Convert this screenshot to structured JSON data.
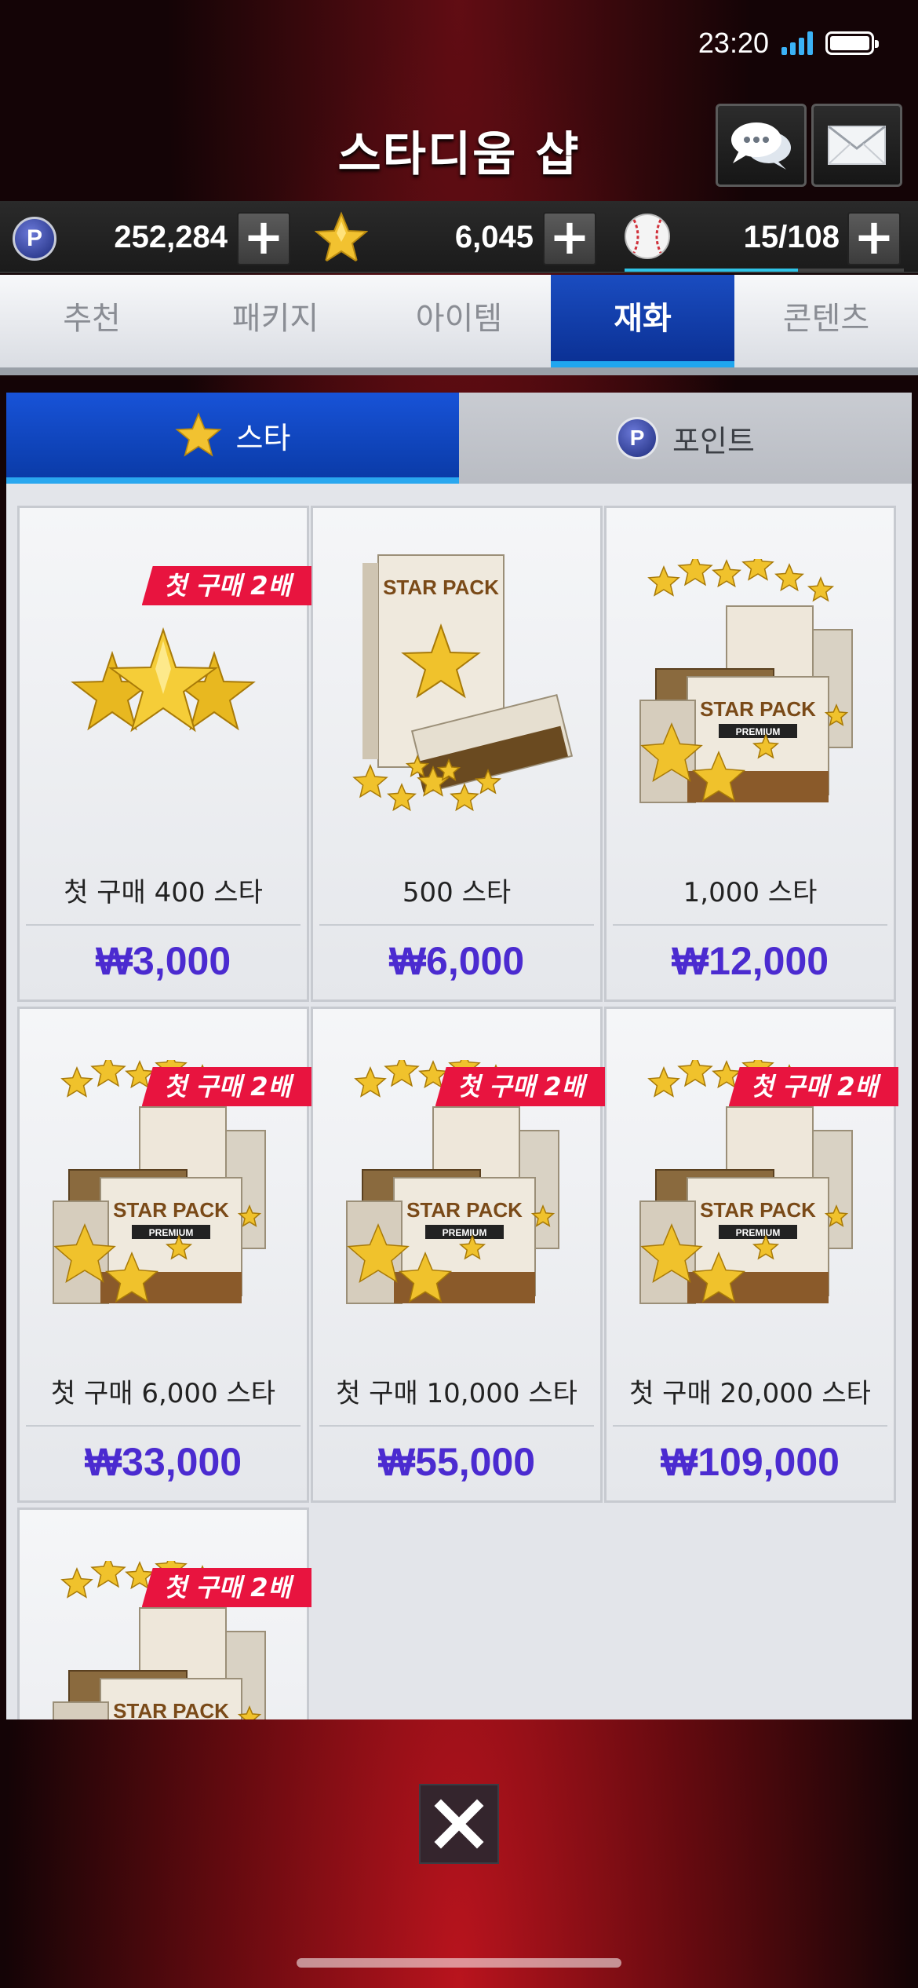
{
  "status_bar": {
    "time": "23:20"
  },
  "header": {
    "title": "스타디움 샵",
    "chat_icon": "chat-bubbles-icon",
    "mail_icon": "envelope-icon"
  },
  "currency": {
    "points": "252,284",
    "stars": "6,045",
    "tickets": "15/108",
    "plus": "+",
    "points_icon_letter": "P"
  },
  "tabs": [
    {
      "label": "추천"
    },
    {
      "label": "패키지"
    },
    {
      "label": "아이템"
    },
    {
      "label": "재화",
      "active": true
    },
    {
      "label": "콘텐츠"
    }
  ],
  "subtabs": [
    {
      "label": "스타",
      "active": true
    },
    {
      "label": "포인트"
    }
  ],
  "badge_text": "첫 구매 2배",
  "products": [
    {
      "name": "첫 구매 400 스타",
      "price": "₩3,000",
      "badge": true,
      "image": "stars-icon"
    },
    {
      "name": "500 스타",
      "price": "₩6,000",
      "badge": false,
      "image": "star-pack-box-icon"
    },
    {
      "name": "1,000 스타",
      "price": "₩12,000",
      "badge": false,
      "image": "star-pack-premium-icon"
    },
    {
      "name": "첫 구매 6,000 스타",
      "price": "₩33,000",
      "badge": true,
      "image": "star-pack-premium-icon"
    },
    {
      "name": "첫 구매 10,000 스타",
      "price": "₩55,000",
      "badge": true,
      "image": "star-pack-premium-icon"
    },
    {
      "name": "첫 구매 20,000 스타",
      "price": "₩109,000",
      "badge": true,
      "image": "star-pack-premium-icon"
    },
    {
      "name": "",
      "price": "",
      "badge": true,
      "image": "star-pack-premium-icon"
    }
  ],
  "pack_label": "STAR PACK",
  "pack_sub": "PREMIUM",
  "colors": {
    "accent_blue": "#0a3ba8",
    "tab_underline": "#20a6ef",
    "badge_red": "#e8143f",
    "price_purple": "#4b2bd0",
    "ticket_progress": "#2fc3e6"
  },
  "ticket_progress": 0.62
}
